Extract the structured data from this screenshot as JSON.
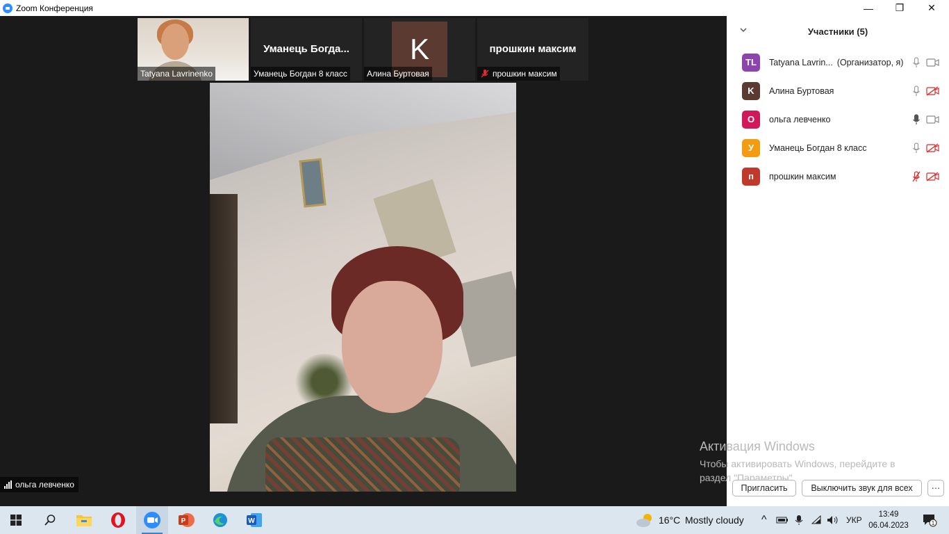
{
  "window": {
    "title": "Zoom Конференция",
    "minimize_glyph": "—",
    "restore_glyph": "❐",
    "close_glyph": "✕"
  },
  "gallery": {
    "thumbs": [
      {
        "display": "video",
        "label": "Tatyana Lavrinenko"
      },
      {
        "display": "name",
        "big_name": "Уманець  Богда...",
        "label": "Уманець Богдан 8 класс"
      },
      {
        "display": "avatar",
        "avatar_letter": "K",
        "label": "Алина Буртовая"
      },
      {
        "display": "name",
        "big_name": "прошкин максим",
        "label": "прошкин максим",
        "muted": true
      }
    ],
    "active_speaker": "ольга левченко"
  },
  "participants": {
    "header": "Участники (5)",
    "list": [
      {
        "initials": "TL",
        "color": "#8e44ad",
        "name": "Tatyana Lavrin...",
        "role": "(Организатор, я)",
        "mic": "on",
        "cam": "on"
      },
      {
        "initials": "K",
        "color": "#5b3a32",
        "name": "Алина Буртовая",
        "role": "",
        "mic": "on",
        "cam": "off"
      },
      {
        "initials": "О",
        "color": "#d0185a",
        "name": "ольга левченко",
        "role": "",
        "mic": "active",
        "cam": "on"
      },
      {
        "initials": "У",
        "color": "#f39c12",
        "name": "Уманець Богдан 8 класс",
        "role": "",
        "mic": "on",
        "cam": "off"
      },
      {
        "initials": "п",
        "color": "#c0392b",
        "name": "прошкин максим",
        "role": "",
        "mic": "off",
        "cam": "off"
      }
    ],
    "invite_button": "Пригласить",
    "mute_all_button": "Выключить звук для всех",
    "more_button": "···"
  },
  "watermark": {
    "line1": "Активация Windows",
    "line2": "Чтобы активировать Windows, перейдите в раздел \"Параметры\"."
  },
  "taskbar": {
    "weather_temp": "16°C",
    "weather_text": "Mostly cloudy",
    "tray_chevron": "^",
    "language": "УКР",
    "time": "13:49",
    "date": "06.04.2023",
    "notification_count": "1"
  },
  "colors": {
    "accent": "#2d8cff",
    "muted_red": "#e02828"
  }
}
